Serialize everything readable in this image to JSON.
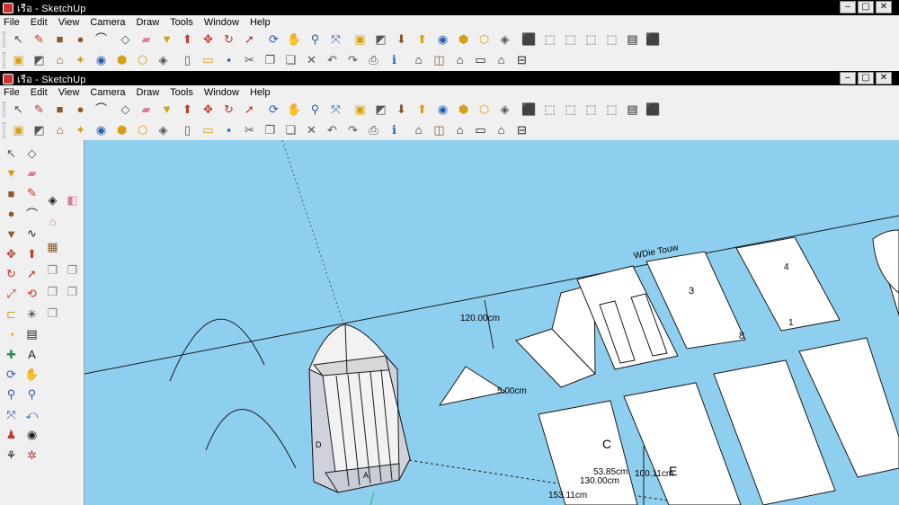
{
  "window_top": {
    "title": "เรือ - SketchUp",
    "menu": [
      "File",
      "Edit",
      "View",
      "Camera",
      "Draw",
      "Tools",
      "Window",
      "Help"
    ],
    "controls": {
      "minimize": "‒",
      "maximize": "▢",
      "close": "✕"
    }
  },
  "window_main": {
    "title": "เรือ - SketchUp",
    "menu": [
      "File",
      "Edit",
      "View",
      "Camera",
      "Draw",
      "Tools",
      "Window",
      "Help"
    ],
    "controls": {
      "minimize": "‒",
      "maximize": "▢",
      "close": "✕"
    }
  },
  "toolbar_row1": [
    {
      "name": "select-tool-icon",
      "glyph": "↖",
      "color": "#555555"
    },
    {
      "name": "pencil-icon",
      "glyph": "✎",
      "color": "#c0392b"
    },
    {
      "name": "rectangle-icon",
      "glyph": "■",
      "color": "#8b5a2b"
    },
    {
      "name": "circle-icon",
      "glyph": "●",
      "color": "#8b5a2b"
    },
    {
      "name": "arc-icon",
      "glyph": "⌒",
      "color": "#222222"
    },
    {
      "name": "make-component-icon",
      "glyph": "◇",
      "color": "#555555"
    },
    {
      "name": "eraser-icon",
      "glyph": "▰",
      "color": "#e07aa0"
    },
    {
      "name": "paint-bucket-icon",
      "glyph": "▼",
      "color": "#d4a017"
    },
    {
      "name": "push-pull-icon",
      "glyph": "⬆",
      "color": "#c0392b"
    },
    {
      "name": "move-icon",
      "glyph": "✥",
      "color": "#c0392b"
    },
    {
      "name": "rotate-icon",
      "glyph": "↻",
      "color": "#c0392b"
    },
    {
      "name": "follow-me-icon",
      "glyph": "➚",
      "color": "#c0392b"
    },
    {
      "name": "orbit-icon",
      "glyph": "⟳",
      "color": "#2a5db0"
    },
    {
      "name": "pan-icon",
      "glyph": "✋",
      "color": "#555555"
    },
    {
      "name": "zoom-icon",
      "glyph": "⚲",
      "color": "#2a5db0"
    },
    {
      "name": "zoom-extents-icon",
      "glyph": "⤧",
      "color": "#2a5db0"
    },
    {
      "name": "get-photo-texture-icon",
      "glyph": "▣",
      "color": "#d4a017"
    },
    {
      "name": "preview-icon",
      "glyph": "◩",
      "color": "#555555"
    },
    {
      "name": "get-models-icon",
      "glyph": "⬇",
      "color": "#8b5a2b"
    },
    {
      "name": "share-model-icon",
      "glyph": "⬆",
      "color": "#d4a017"
    },
    {
      "name": "google-earth-icon",
      "glyph": "◉",
      "color": "#2a5db0"
    },
    {
      "name": "component-icon",
      "glyph": "⬢",
      "color": "#d4a017"
    },
    {
      "name": "share-component-icon",
      "glyph": "⬡",
      "color": "#d4a017"
    },
    {
      "name": "dynamic-component-icon",
      "glyph": "◈",
      "color": "#555555"
    },
    {
      "name": "iso-view-icon",
      "glyph": "⬛",
      "color": "#2a5db0"
    },
    {
      "name": "xray-icon",
      "glyph": "⬚",
      "color": "#555555"
    },
    {
      "name": "wireframe-icon",
      "glyph": "⬚",
      "color": "#555555"
    },
    {
      "name": "hidden-line-icon",
      "glyph": "⬚",
      "color": "#555555"
    },
    {
      "name": "shaded-icon",
      "glyph": "⬚",
      "color": "#555555"
    },
    {
      "name": "shaded-textures-icon",
      "glyph": "▤",
      "color": "#222222"
    },
    {
      "name": "monochrome-icon",
      "glyph": "⬛",
      "color": "#2a5db0"
    }
  ],
  "toolbar_row2": [
    {
      "name": "get-current-view-icon",
      "glyph": "▣",
      "color": "#d4a017"
    },
    {
      "name": "photo-view-icon",
      "glyph": "◩",
      "color": "#555555"
    },
    {
      "name": "house-model-icon",
      "glyph": "⌂",
      "color": "#8b5a2b"
    },
    {
      "name": "place-model-icon",
      "glyph": "✦",
      "color": "#d4a017"
    },
    {
      "name": "earth-globe-icon",
      "glyph": "◉",
      "color": "#2a5db0"
    },
    {
      "name": "component-gold-icon",
      "glyph": "⬢",
      "color": "#d4a017"
    },
    {
      "name": "share-gold-icon",
      "glyph": "⬡",
      "color": "#d4a017"
    },
    {
      "name": "dynamic-gray-icon",
      "glyph": "◈",
      "color": "#555555"
    },
    {
      "name": "new-file-icon",
      "glyph": "▯",
      "color": "#555555"
    },
    {
      "name": "open-folder-icon",
      "glyph": "▭",
      "color": "#d4a017"
    },
    {
      "name": "save-icon",
      "glyph": "▪",
      "color": "#2a5db0"
    },
    {
      "name": "cut-icon",
      "glyph": "✂",
      "color": "#555555"
    },
    {
      "name": "copy-icon",
      "glyph": "❐",
      "color": "#555555"
    },
    {
      "name": "paste-icon",
      "glyph": "❑",
      "color": "#555555"
    },
    {
      "name": "delete-icon",
      "glyph": "✕",
      "color": "#555555"
    },
    {
      "name": "undo-icon",
      "glyph": "↶",
      "color": "#555555"
    },
    {
      "name": "redo-icon",
      "glyph": "↷",
      "color": "#555555"
    },
    {
      "name": "print-icon",
      "glyph": "⎙",
      "color": "#555555"
    },
    {
      "name": "model-info-icon",
      "glyph": "ℹ",
      "color": "#2a5db0"
    },
    {
      "name": "iso-house-icon",
      "glyph": "⌂",
      "color": "#222222"
    },
    {
      "name": "top-house-icon",
      "glyph": "◫",
      "color": "#8b5a2b"
    },
    {
      "name": "front-house-icon",
      "glyph": "⌂",
      "color": "#222222"
    },
    {
      "name": "right-house-icon",
      "glyph": "▭",
      "color": "#222222"
    },
    {
      "name": "back-house-icon",
      "glyph": "⌂",
      "color": "#222222"
    },
    {
      "name": "left-house-icon",
      "glyph": "⊟",
      "color": "#222222"
    }
  ],
  "left_toolbar": [
    {
      "name": "select-icon",
      "glyph": "↖",
      "color": "#555555"
    },
    {
      "name": "make-component-icon",
      "glyph": "◇",
      "color": "#555555"
    },
    {
      "name": "paint-bucket-icon",
      "glyph": "▼",
      "color": "#d4a017"
    },
    {
      "name": "eraser-icon",
      "glyph": "▰",
      "color": "#e07aa0"
    },
    {
      "name": "rectangle-icon",
      "glyph": "■",
      "color": "#8b5a2b"
    },
    {
      "name": "line-icon",
      "glyph": "✎",
      "color": "#c0392b"
    },
    {
      "name": "circle-icon",
      "glyph": "●",
      "color": "#8b5a2b"
    },
    {
      "name": "arc-icon",
      "glyph": "⌒",
      "color": "#222222"
    },
    {
      "name": "polygon-icon",
      "glyph": "▼",
      "color": "#8b5a2b"
    },
    {
      "name": "freehand-icon",
      "glyph": "∿",
      "color": "#222222"
    },
    {
      "name": "move-icon",
      "glyph": "✥",
      "color": "#c0392b"
    },
    {
      "name": "push-pull-icon",
      "glyph": "⬆",
      "color": "#c0392b"
    },
    {
      "name": "rotate-icon",
      "glyph": "↻",
      "color": "#c0392b"
    },
    {
      "name": "follow-me-icon",
      "glyph": "➚",
      "color": "#c0392b"
    },
    {
      "name": "scale-icon",
      "glyph": "⤢",
      "color": "#c0392b"
    },
    {
      "name": "offset-icon",
      "glyph": "⟲",
      "color": "#c0392b"
    },
    {
      "name": "tape-measure-icon",
      "glyph": "⊏",
      "color": "#d4a017"
    },
    {
      "name": "dimension-icon",
      "glyph": "✳",
      "color": "#222222"
    },
    {
      "name": "protractor-icon",
      "glyph": "◔",
      "color": "#d4a017"
    },
    {
      "name": "text-icon",
      "glyph": "▤",
      "color": "#222222"
    },
    {
      "name": "axes-icon",
      "glyph": "✚",
      "color": "#2e8b57"
    },
    {
      "name": "3d-text-icon",
      "glyph": "A",
      "color": "#222222"
    },
    {
      "name": "orbit-icon",
      "glyph": "⟳",
      "color": "#2a5db0"
    },
    {
      "name": "pan-icon",
      "glyph": "✋",
      "color": "#555555"
    },
    {
      "name": "zoom-icon",
      "glyph": "⚲",
      "color": "#2a5db0"
    },
    {
      "name": "zoom-window-icon",
      "glyph": "⚲",
      "color": "#2a5db0"
    },
    {
      "name": "zoom-extents-icon",
      "glyph": "⤧",
      "color": "#2a5db0"
    },
    {
      "name": "previous-view-icon",
      "glyph": "⤺",
      "color": "#2a5db0"
    },
    {
      "name": "position-camera-icon",
      "glyph": "♟",
      "color": "#c0392b"
    },
    {
      "name": "look-around-icon",
      "glyph": "◉",
      "color": "#222222"
    },
    {
      "name": "walk-icon",
      "glyph": "⚘",
      "color": "#222222"
    },
    {
      "name": "section-plane-icon",
      "glyph": "✲",
      "color": "#c0392b"
    }
  ],
  "side_panel": [
    {
      "name": "section-arrow-icon",
      "glyph": "◈",
      "color": "#222222"
    },
    {
      "name": "section-display-icon",
      "glyph": "◧",
      "color": "#e07aa0"
    },
    {
      "name": "house-section-icon",
      "glyph": "⌂",
      "color": "#e07aa0"
    },
    {
      "name": "layers-icon",
      "glyph": "▦",
      "color": "#8b5a2b"
    },
    {
      "name": "layer-copy-1-icon",
      "glyph": "❐",
      "color": "#888888"
    },
    {
      "name": "layer-copy-2-icon",
      "glyph": "❐",
      "color": "#888888"
    },
    {
      "name": "layer-copy-3-icon",
      "glyph": "❐",
      "color": "#888888"
    },
    {
      "name": "layer-copy-4-icon",
      "glyph": "❐",
      "color": "#888888"
    },
    {
      "name": "layer-copy-5-icon",
      "glyph": "❐",
      "color": "#888888"
    }
  ],
  "viewport": {
    "background": "#8ecfef",
    "labels": {
      "dim_120": "120.00cm",
      "dim_5": "5.00cm",
      "street": "WDie Touw",
      "dim_153": "153.11cm",
      "dim_130": "130.00cm",
      "dim_53": "53.85cm",
      "dim_100": "100.11cm",
      "block_3": "3",
      "block_8": "8",
      "block_C": "C",
      "block_E": "E",
      "block_4": "4",
      "block_1": "1",
      "hull_D": "D",
      "hull_A": "A"
    }
  }
}
